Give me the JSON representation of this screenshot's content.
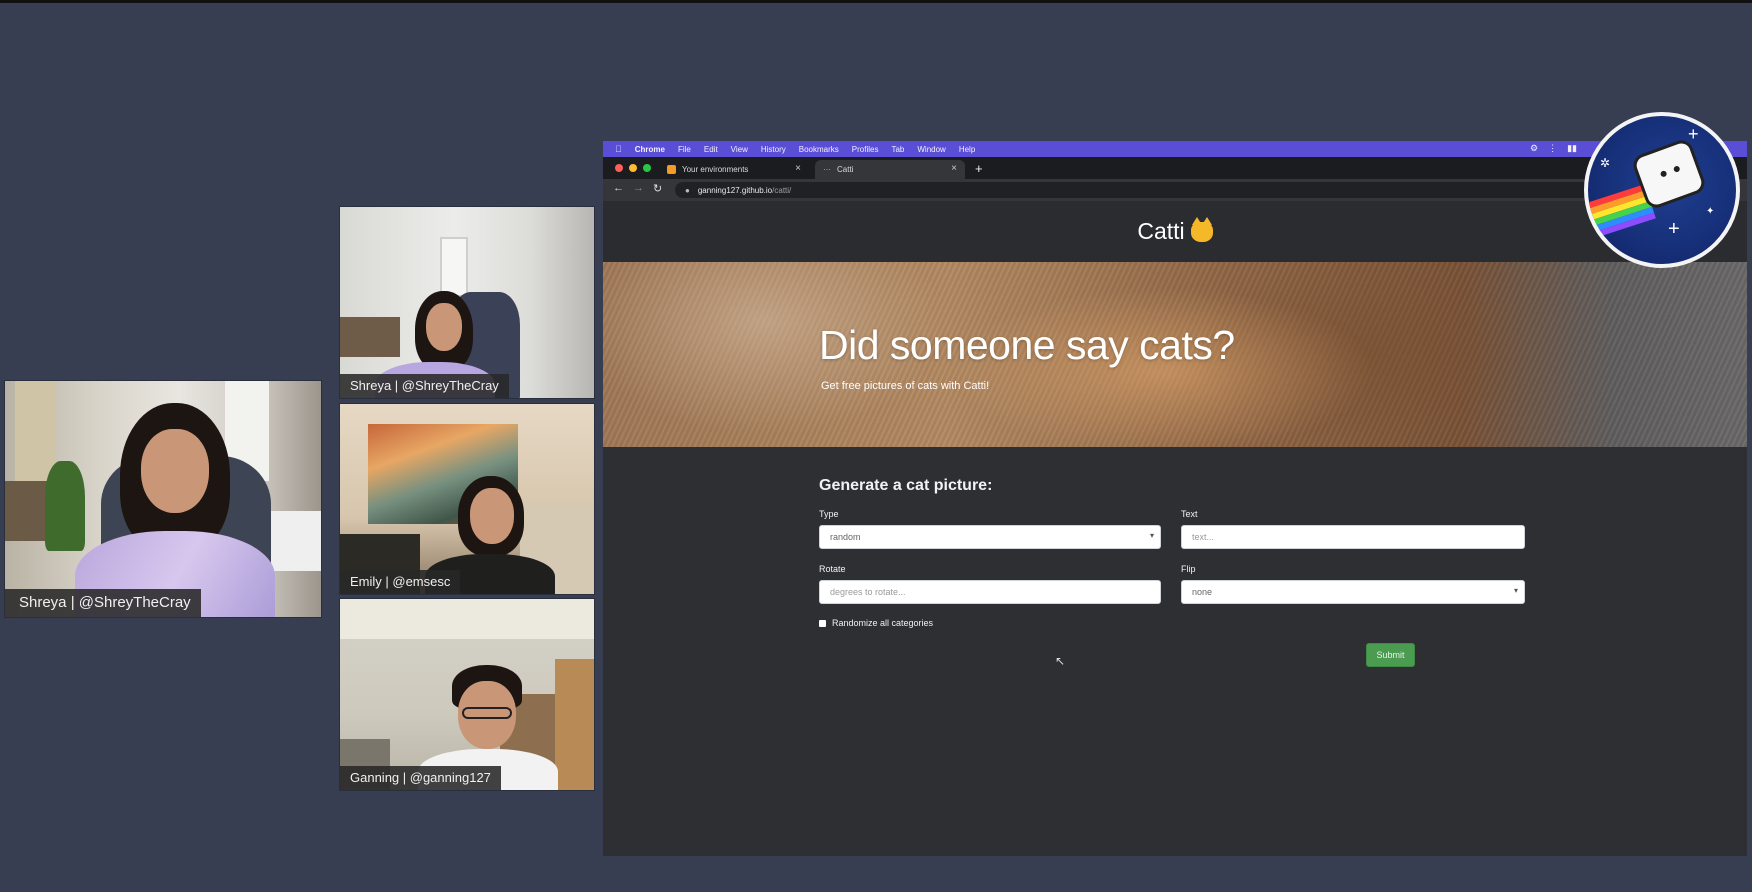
{
  "participants": [
    {
      "name_tag": "Shreya | @ShreyTheCray"
    },
    {
      "name_tag": "Shreya | @ShreyTheCray"
    },
    {
      "name_tag": "Emily | @emsesc"
    },
    {
      "name_tag": "Ganning | @ganning127"
    }
  ],
  "menubar": {
    "app": "Chrome",
    "items": [
      "File",
      "Edit",
      "View",
      "History",
      "Bookmarks",
      "Profiles",
      "Tab",
      "Window",
      "Help"
    ]
  },
  "tabs": [
    {
      "title": "Your environments"
    },
    {
      "title": "Catti"
    }
  ],
  "address": {
    "host": "ganning127.github.io",
    "path": "/catti/"
  },
  "site": {
    "brand": "Catti",
    "hero_title": "Did someone say cats?",
    "hero_subtitle": "Get free pictures of cats with Catti!"
  },
  "form": {
    "title": "Generate a cat picture:",
    "type_label": "Type",
    "type_value": "random",
    "text_label": "Text",
    "text_placeholder": "text...",
    "rotate_label": "Rotate",
    "rotate_placeholder": "degrees to rotate...",
    "flip_label": "Flip",
    "flip_value": "none",
    "randomize_label": "Randomize all categories",
    "submit_label": "Submit"
  },
  "colors": {
    "page_background": "#373e52",
    "menubar": "#5a4ed6",
    "submit_button": "#4b9b50"
  }
}
